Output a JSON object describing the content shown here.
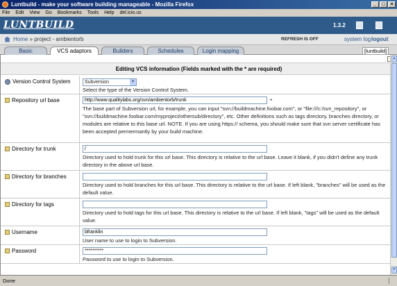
{
  "window": {
    "title": "Luntbuild - make your software building manageable - Mozilla Firefox",
    "buttons": [
      "_",
      "□",
      "×"
    ]
  },
  "menu": [
    "File",
    "Edit",
    "View",
    "Go",
    "Bookmarks",
    "Tools",
    "Help",
    "del.icio.us"
  ],
  "app": {
    "logo": "LUNTBUILD",
    "version": "1.3.2"
  },
  "breadcrumb": {
    "home": "Home",
    "separator": "»",
    "project": "project - ambientorb"
  },
  "header_links": {
    "refresh": "REFRESH IS OFF",
    "system_log": "system log",
    "logout": "logout"
  },
  "tabs": [
    {
      "label": "Basic",
      "active": false
    },
    {
      "label": "VCS adaptors",
      "active": true
    },
    {
      "label": "Builders",
      "active": false
    },
    {
      "label": "Schedules",
      "active": false
    },
    {
      "label": "Login mapping",
      "active": false
    }
  ],
  "project_tag": "[luntbuild]",
  "form": {
    "title": "Editing VCS information (Fields marked with the * are required)",
    "rows": [
      {
        "label": "Version Control System",
        "select_value": "Subversion",
        "help": "Select the type of the Version Control System."
      },
      {
        "label": "Repository url base",
        "value": "http://www.qualitylabs.org/svn/ambientorb/trunk",
        "required_mark": "*",
        "help": "The base part of Subversion url, for example, you can input \"svn://buildmachine.foobar.com\", or \"file:///c:/svn_repository\", or \"svn://buildmachine.foobar.com/myproject/othersub/directory\", etc. Other definitions such as tags directory, branches directory, or modules are relative to this base url. NOTE. If you are using https:// schema, you should make sure that svn server certificate has been accepted permermantly by your build machine."
      },
      {
        "label": "Directory for trunk",
        "value": "/",
        "help": "Directory used to hold trunk for this url base. This directory is relative to the url base. Leave it blank, if you didn't define any trunk directory in the above url base."
      },
      {
        "label": "Directory for branches",
        "value": "",
        "help": "Directory used to hold branches for this url base. This directory is relative to the url base. If left blank, \"branches\" will be used as the default value."
      },
      {
        "label": "Directory for tags",
        "value": "",
        "help": "Directory used to hold tags for this url base. This directory is relative to the url base. If left blank, \"tags\" will be used as the default value."
      },
      {
        "label": "Username",
        "value": "bfranklin",
        "help": "User name to use to login to Subversion."
      },
      {
        "label": "Password",
        "value": "**********",
        "help": "Password to use to login to Subversion."
      }
    ]
  },
  "status": "Done"
}
